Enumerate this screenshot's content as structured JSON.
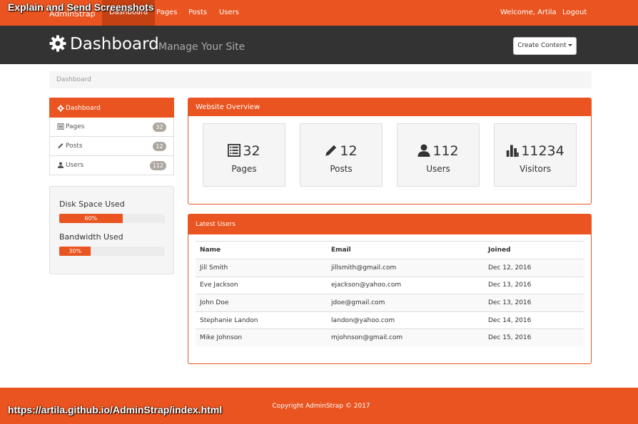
{
  "overlay": {
    "title": "Explain and Send Screenshots",
    "url": "https://artila.github.io/AdminStrap/index.html"
  },
  "navbar": {
    "brand": "AdminStrap",
    "items": [
      {
        "label": "Dashboard",
        "active": true
      },
      {
        "label": "Pages"
      },
      {
        "label": "Posts"
      },
      {
        "label": "Users"
      }
    ],
    "welcome": "Welcome, Artila",
    "logout": "Logout"
  },
  "header": {
    "icon": "gear-icon",
    "title": "Dashboard",
    "subtitle": "Manage Your Site",
    "create_button": "Create Content"
  },
  "breadcrumb": "Dashboard",
  "sidebar": {
    "items": [
      {
        "label": "Dashboard",
        "icon": "gear-icon",
        "active": true
      },
      {
        "label": "Pages",
        "icon": "list-icon",
        "badge": "32"
      },
      {
        "label": "Posts",
        "icon": "pencil-icon",
        "badge": "12"
      },
      {
        "label": "Users",
        "icon": "user-icon",
        "badge": "112"
      }
    ],
    "disk": {
      "label": "Disk Space Used",
      "value": 60,
      "text": "60%"
    },
    "bandwidth": {
      "label": "Bandwidth Used",
      "value": 30,
      "text": "30%"
    }
  },
  "overview": {
    "title": "Website Overview",
    "stats": [
      {
        "icon": "list-icon",
        "value": "32",
        "label": "Pages"
      },
      {
        "icon": "pencil-icon",
        "value": "12",
        "label": "Posts"
      },
      {
        "icon": "user-icon",
        "value": "112",
        "label": "Users"
      },
      {
        "icon": "bar-chart-icon",
        "value": "11234",
        "label": "Visitors"
      }
    ]
  },
  "latest_users": {
    "title": "Latest Users",
    "columns": [
      "Name",
      "Email",
      "Joined"
    ],
    "rows": [
      [
        "Jill Smith",
        "jillsmith@gmail.com",
        "Dec 12, 2016"
      ],
      [
        "Eve Jackson",
        "ejackson@yahoo.com",
        "Dec 13, 2016"
      ],
      [
        "John Doe",
        "jdoe@gmail.com",
        "Dec 13, 2016"
      ],
      [
        "Stephanie Landon",
        "landon@yahoo.com",
        "Dec 14, 2016"
      ],
      [
        "Mike Johnson",
        "mjohnson@gmail.com",
        "Dec 15, 2016"
      ]
    ]
  },
  "footer": {
    "copyright": "Copyright AdminStrap © 2017"
  },
  "colors": {
    "accent": "#e95420",
    "header": "#333333",
    "badge": "#aea79f"
  }
}
